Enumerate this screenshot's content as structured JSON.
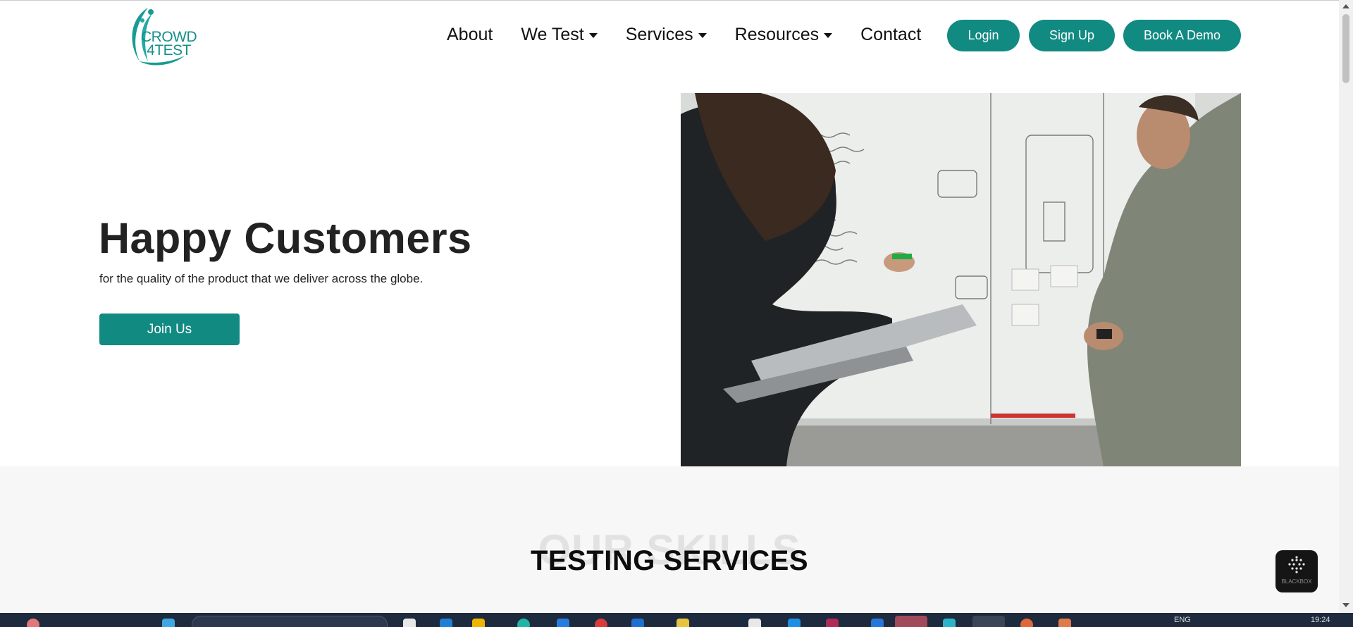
{
  "header": {
    "logo_alt": "CROWD 4TEST",
    "logo_line1": "CROWD",
    "logo_line2": "4TEST",
    "nav": [
      {
        "label": "About",
        "dropdown": false
      },
      {
        "label": "We Test",
        "dropdown": true
      },
      {
        "label": "Services",
        "dropdown": true
      },
      {
        "label": "Resources",
        "dropdown": true
      },
      {
        "label": "Contact",
        "dropdown": false
      }
    ],
    "login_label": "Login",
    "signup_label": "Sign Up",
    "demo_label": "Book A Demo"
  },
  "hero": {
    "title": "Happy Customers",
    "subtitle": "for the quality of the product that we deliver across the globe.",
    "join_label": "Join Us"
  },
  "skills": {
    "bg_word": "OUR SKILLS",
    "title": "TESTING SERVICES"
  },
  "widget": {
    "label": "BLACKBOX"
  },
  "taskbar": {
    "lang": "ENG",
    "time": "19:24"
  },
  "colors": {
    "brand": "#118a82",
    "section_bg": "#f7f7f7",
    "taskbar_bg": "#1e2a3d"
  }
}
